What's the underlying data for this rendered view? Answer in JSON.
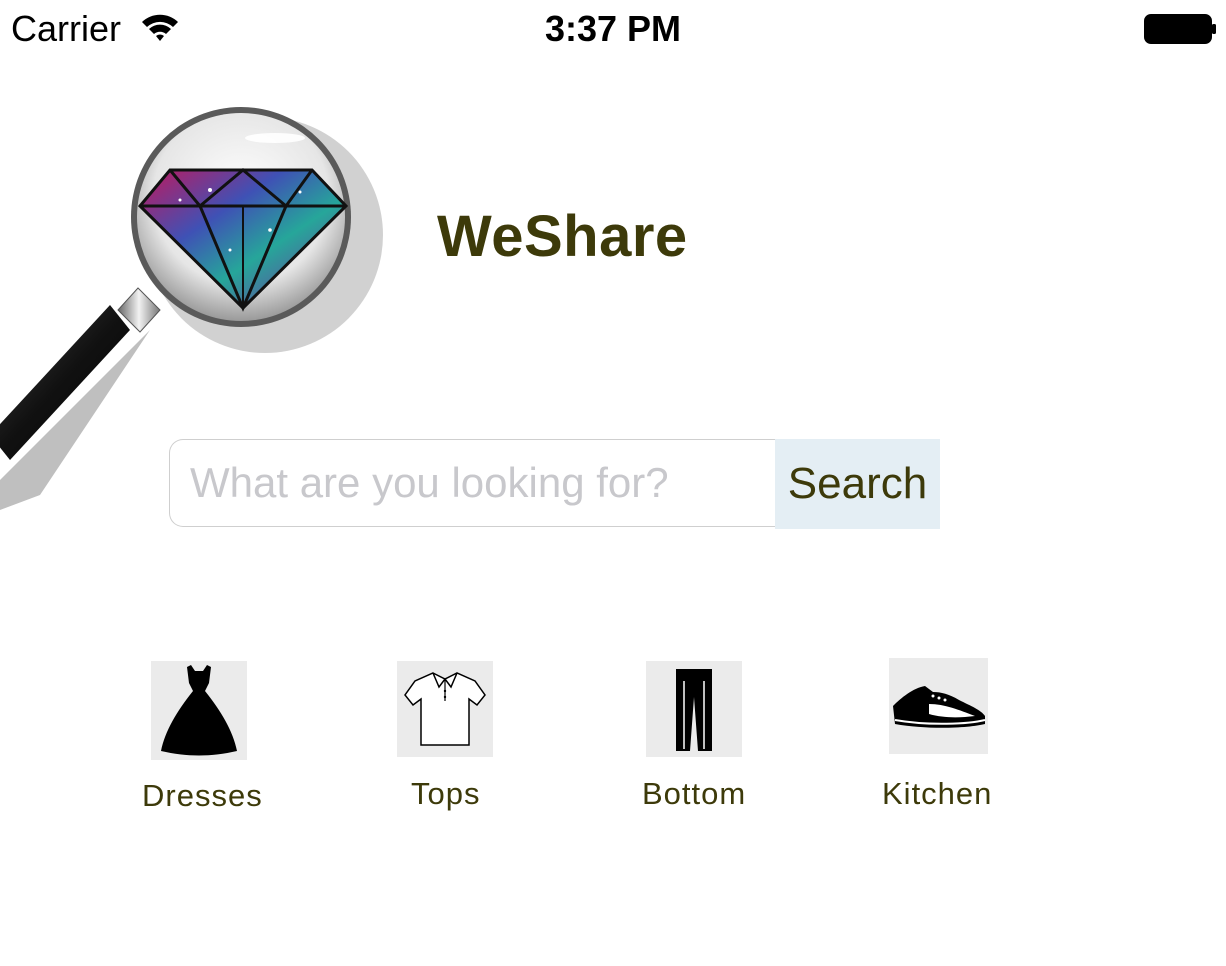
{
  "status_bar": {
    "carrier": "Carrier",
    "time": "3:37 PM",
    "icons": [
      "wifi-icon",
      "battery-icon"
    ]
  },
  "header": {
    "logo_icon": "magnifier-diamond-logo",
    "title": "WeShare"
  },
  "search": {
    "placeholder": "What are you looking for?",
    "value": "",
    "button_label": "Search"
  },
  "categories": [
    {
      "label": "Dresses",
      "icon": "dress-icon"
    },
    {
      "label": "Tops",
      "icon": "shirt-icon"
    },
    {
      "label": "Bottom",
      "icon": "pants-icon"
    },
    {
      "label": "Kitchen",
      "icon": "sneaker-icon"
    }
  ],
  "colors": {
    "brand_text": "#3d3a0a",
    "search_button_bg": "#e4eef4",
    "placeholder": "#c8c8cc",
    "icon_bg": "#ebebeb"
  }
}
